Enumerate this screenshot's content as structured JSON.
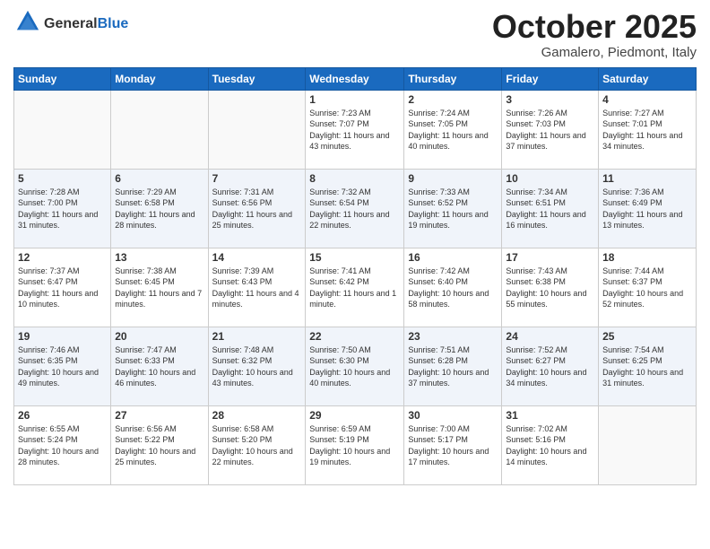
{
  "header": {
    "logo_general": "General",
    "logo_blue": "Blue",
    "month": "October 2025",
    "location": "Gamalero, Piedmont, Italy"
  },
  "weekdays": [
    "Sunday",
    "Monday",
    "Tuesday",
    "Wednesday",
    "Thursday",
    "Friday",
    "Saturday"
  ],
  "weeks": [
    [
      {
        "day": "",
        "info": ""
      },
      {
        "day": "",
        "info": ""
      },
      {
        "day": "",
        "info": ""
      },
      {
        "day": "1",
        "info": "Sunrise: 7:23 AM\nSunset: 7:07 PM\nDaylight: 11 hours and 43 minutes."
      },
      {
        "day": "2",
        "info": "Sunrise: 7:24 AM\nSunset: 7:05 PM\nDaylight: 11 hours and 40 minutes."
      },
      {
        "day": "3",
        "info": "Sunrise: 7:26 AM\nSunset: 7:03 PM\nDaylight: 11 hours and 37 minutes."
      },
      {
        "day": "4",
        "info": "Sunrise: 7:27 AM\nSunset: 7:01 PM\nDaylight: 11 hours and 34 minutes."
      }
    ],
    [
      {
        "day": "5",
        "info": "Sunrise: 7:28 AM\nSunset: 7:00 PM\nDaylight: 11 hours and 31 minutes."
      },
      {
        "day": "6",
        "info": "Sunrise: 7:29 AM\nSunset: 6:58 PM\nDaylight: 11 hours and 28 minutes."
      },
      {
        "day": "7",
        "info": "Sunrise: 7:31 AM\nSunset: 6:56 PM\nDaylight: 11 hours and 25 minutes."
      },
      {
        "day": "8",
        "info": "Sunrise: 7:32 AM\nSunset: 6:54 PM\nDaylight: 11 hours and 22 minutes."
      },
      {
        "day": "9",
        "info": "Sunrise: 7:33 AM\nSunset: 6:52 PM\nDaylight: 11 hours and 19 minutes."
      },
      {
        "day": "10",
        "info": "Sunrise: 7:34 AM\nSunset: 6:51 PM\nDaylight: 11 hours and 16 minutes."
      },
      {
        "day": "11",
        "info": "Sunrise: 7:36 AM\nSunset: 6:49 PM\nDaylight: 11 hours and 13 minutes."
      }
    ],
    [
      {
        "day": "12",
        "info": "Sunrise: 7:37 AM\nSunset: 6:47 PM\nDaylight: 11 hours and 10 minutes."
      },
      {
        "day": "13",
        "info": "Sunrise: 7:38 AM\nSunset: 6:45 PM\nDaylight: 11 hours and 7 minutes."
      },
      {
        "day": "14",
        "info": "Sunrise: 7:39 AM\nSunset: 6:43 PM\nDaylight: 11 hours and 4 minutes."
      },
      {
        "day": "15",
        "info": "Sunrise: 7:41 AM\nSunset: 6:42 PM\nDaylight: 11 hours and 1 minute."
      },
      {
        "day": "16",
        "info": "Sunrise: 7:42 AM\nSunset: 6:40 PM\nDaylight: 10 hours and 58 minutes."
      },
      {
        "day": "17",
        "info": "Sunrise: 7:43 AM\nSunset: 6:38 PM\nDaylight: 10 hours and 55 minutes."
      },
      {
        "day": "18",
        "info": "Sunrise: 7:44 AM\nSunset: 6:37 PM\nDaylight: 10 hours and 52 minutes."
      }
    ],
    [
      {
        "day": "19",
        "info": "Sunrise: 7:46 AM\nSunset: 6:35 PM\nDaylight: 10 hours and 49 minutes."
      },
      {
        "day": "20",
        "info": "Sunrise: 7:47 AM\nSunset: 6:33 PM\nDaylight: 10 hours and 46 minutes."
      },
      {
        "day": "21",
        "info": "Sunrise: 7:48 AM\nSunset: 6:32 PM\nDaylight: 10 hours and 43 minutes."
      },
      {
        "day": "22",
        "info": "Sunrise: 7:50 AM\nSunset: 6:30 PM\nDaylight: 10 hours and 40 minutes."
      },
      {
        "day": "23",
        "info": "Sunrise: 7:51 AM\nSunset: 6:28 PM\nDaylight: 10 hours and 37 minutes."
      },
      {
        "day": "24",
        "info": "Sunrise: 7:52 AM\nSunset: 6:27 PM\nDaylight: 10 hours and 34 minutes."
      },
      {
        "day": "25",
        "info": "Sunrise: 7:54 AM\nSunset: 6:25 PM\nDaylight: 10 hours and 31 minutes."
      }
    ],
    [
      {
        "day": "26",
        "info": "Sunrise: 6:55 AM\nSunset: 5:24 PM\nDaylight: 10 hours and 28 minutes."
      },
      {
        "day": "27",
        "info": "Sunrise: 6:56 AM\nSunset: 5:22 PM\nDaylight: 10 hours and 25 minutes."
      },
      {
        "day": "28",
        "info": "Sunrise: 6:58 AM\nSunset: 5:20 PM\nDaylight: 10 hours and 22 minutes."
      },
      {
        "day": "29",
        "info": "Sunrise: 6:59 AM\nSunset: 5:19 PM\nDaylight: 10 hours and 19 minutes."
      },
      {
        "day": "30",
        "info": "Sunrise: 7:00 AM\nSunset: 5:17 PM\nDaylight: 10 hours and 17 minutes."
      },
      {
        "day": "31",
        "info": "Sunrise: 7:02 AM\nSunset: 5:16 PM\nDaylight: 10 hours and 14 minutes."
      },
      {
        "day": "",
        "info": ""
      }
    ]
  ]
}
